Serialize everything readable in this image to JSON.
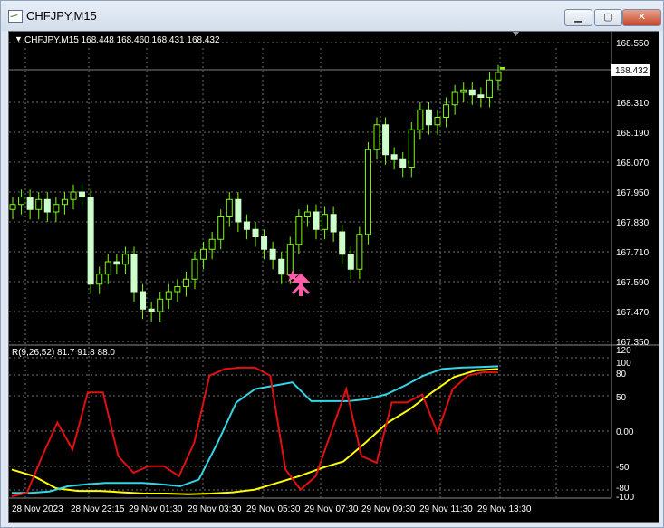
{
  "window": {
    "title": "CHFJPY,M15",
    "minimize_glyph": "▁",
    "maximize_glyph": "▢",
    "close_glyph": "✕"
  },
  "chart": {
    "header": "CHFJPY,M15  168.448 168.460 168.431 168.432",
    "price_labels": [
      "168.550",
      "168.310",
      "168.190",
      "168.070",
      "167.950",
      "167.830",
      "167.710",
      "167.590",
      "167.470",
      "167.350"
    ],
    "current_price": "168.432",
    "time_labels": [
      "28 Nov 2023",
      "28 Nov 23:15",
      "29 Nov 01:30",
      "29 Nov 03:30",
      "29 Nov 05:30",
      "29 Nov 07:30",
      "29 Nov 09:30",
      "29 Nov 11:30",
      "29 Nov 13:30"
    ]
  },
  "indicator": {
    "header": "R(9,26,52) 81.7 91.8 88.0",
    "levels": [
      "120",
      "100",
      "80",
      "50",
      "0.00",
      "-50",
      "-80",
      "-100"
    ]
  },
  "chart_data": {
    "type": "line",
    "title": "CHFJPY,M15",
    "candles_approx": [
      167.9,
      167.93,
      167.88,
      167.92,
      167.87,
      167.9,
      167.92,
      167.95,
      167.93,
      167.58,
      167.62,
      167.67,
      167.66,
      167.7,
      167.55,
      167.48,
      167.47,
      167.52,
      167.55,
      167.57,
      167.6,
      167.68,
      167.72,
      167.76,
      167.85,
      167.92,
      167.83,
      167.8,
      167.77,
      167.72,
      167.68,
      167.62,
      167.74,
      167.85,
      167.87,
      167.8,
      167.86,
      167.79,
      167.7,
      167.64,
      167.78,
      168.12,
      168.22,
      168.1,
      168.08,
      168.05,
      168.2,
      168.28,
      168.22,
      168.25,
      168.3,
      168.35,
      168.36,
      168.34,
      168.33,
      168.4,
      168.43
    ],
    "indicator_series": [
      {
        "name": "red",
        "values": [
          -100,
          -95,
          -40,
          10,
          -30,
          55,
          55,
          -40,
          -65,
          -55,
          -55,
          -70,
          -20,
          80,
          90,
          92,
          92,
          80,
          -60,
          -90,
          -70,
          -5,
          60,
          -40,
          -50,
          40,
          40,
          52,
          -5,
          60,
          80,
          85,
          85
        ]
      },
      {
        "name": "cyan",
        "values": [
          -95,
          -95,
          -93,
          -85,
          -82,
          -80,
          -80,
          -80,
          -82,
          -85,
          -75,
          -20,
          40,
          60,
          65,
          70,
          42,
          42,
          42,
          45,
          52,
          65,
          80,
          90,
          92,
          93,
          94
        ]
      },
      {
        "name": "yellow",
        "values": [
          -60,
          -70,
          -88,
          -92,
          -92,
          -94,
          -96,
          -96,
          -97,
          -96,
          -94,
          -90,
          -80,
          -70,
          -58,
          -48,
          -20,
          10,
          30,
          55,
          78,
          88,
          90
        ]
      }
    ]
  }
}
